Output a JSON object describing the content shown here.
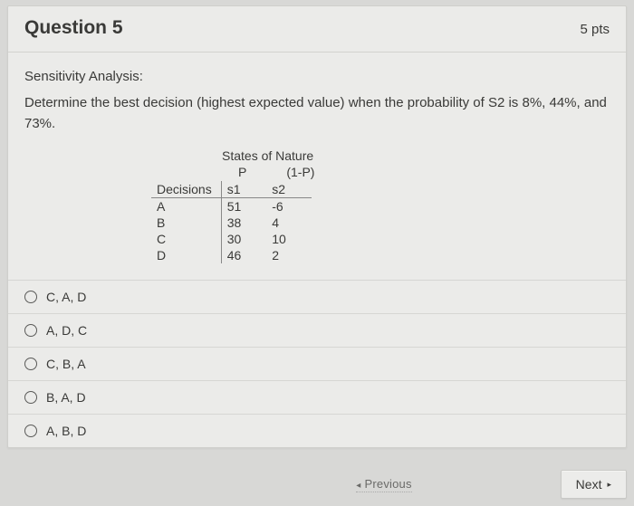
{
  "header": {
    "title": "Question 5",
    "points": "5 pts"
  },
  "prompt": {
    "title": "Sensitivity Analysis:",
    "text": "Determine the best decision (highest expected value) when the probability of S2 is 8%, 44%, and 73%."
  },
  "table": {
    "states_label": "States of Nature",
    "p_label": "P",
    "one_minus_p_label": "(1-P)",
    "decisions_header": "Decisions",
    "s1": "s1",
    "s2": "s2",
    "rows": [
      {
        "dec": "A",
        "v1": "51",
        "v2": "-6"
      },
      {
        "dec": "B",
        "v1": "38",
        "v2": "4"
      },
      {
        "dec": "C",
        "v1": "30",
        "v2": "10"
      },
      {
        "dec": "D",
        "v1": "46",
        "v2": "2"
      }
    ]
  },
  "options": [
    {
      "label": "C, A, D"
    },
    {
      "label": "A, D, C"
    },
    {
      "label": "C, B, A"
    },
    {
      "label": "B, A, D"
    },
    {
      "label": "A, B, D"
    }
  ],
  "nav": {
    "previous": "Previous",
    "next": "Next"
  },
  "chart_data": {
    "type": "table",
    "title": "States of Nature payoff table",
    "columns": [
      "Decisions",
      "s1 (P)",
      "s2 (1-P)"
    ],
    "rows": [
      [
        "A",
        51,
        -6
      ],
      [
        "B",
        38,
        4
      ],
      [
        "C",
        30,
        10
      ],
      [
        "D",
        46,
        2
      ]
    ]
  }
}
